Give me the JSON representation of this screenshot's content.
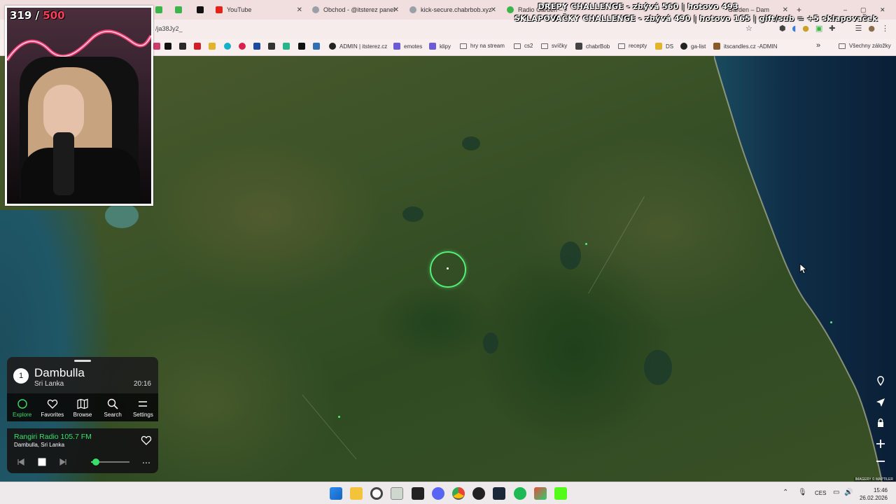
{
  "browser": {
    "tabs": [
      {
        "label": "YouTube",
        "favicon_color": "#e62117"
      },
      {
        "label": "Obchod - @itsterez panel",
        "favicon_color": "#9aa0a6"
      },
      {
        "label": "kick-secure.chabrbob.xyz",
        "favicon_color": "#9aa0a6"
      },
      {
        "label": "Radio Garden – Ke",
        "favicon_color": "#3bb54a"
      },
      {
        "label": "Garden – Dam",
        "favicon_color": "#3bb54a"
      }
    ],
    "new_tab_symbol": "+",
    "url": "/ja38Jy2_",
    "bookmarks": [
      {
        "label": "ADMIN | itsterez.cz",
        "icon_color": "#222"
      },
      {
        "label": "emotes",
        "icon_color": "#6b5bd6"
      },
      {
        "label": "klipy",
        "icon_color": "#6b5bd6"
      },
      {
        "label": "hry na stream",
        "icon_color": "folder"
      },
      {
        "label": "cs2",
        "icon_color": "folder"
      },
      {
        "label": "svíčky",
        "icon_color": "folder"
      },
      {
        "label": "chabrBob",
        "icon_color": "#444"
      },
      {
        "label": "recepty",
        "icon_color": "folder"
      },
      {
        "label": "DS",
        "icon_color": "#e3b42a"
      },
      {
        "label": "ga-list",
        "icon_color": "#222"
      },
      {
        "label": "itscandles.cz -ADMIN",
        "icon_color": "#8a5a2b"
      }
    ],
    "all_bookmarks": "Všechny záložky",
    "overflow_symbol": "»"
  },
  "overlay": {
    "challenge_1": "DREPY CHALLENGE - zbývá 560 | hotovo 493",
    "challenge_2": "SKLAPOVAČKY CHALLENGE - zbývá 490 | hotovo 165 | gift/sub = +5 sklapovaček",
    "counter_current": "319",
    "counter_sep": " / ",
    "counter_goal": "500"
  },
  "radio": {
    "rank": "1",
    "city": "Dambulla",
    "country": "Sri Lanka",
    "local_time": "20:16",
    "nav": [
      {
        "label": "Explore",
        "icon": "explore-icon",
        "active": true
      },
      {
        "label": "Favorites",
        "icon": "heart-icon",
        "active": false
      },
      {
        "label": "Browse",
        "icon": "map-icon",
        "active": false
      },
      {
        "label": "Search",
        "icon": "search-icon",
        "active": false
      },
      {
        "label": "Settings",
        "icon": "menu-icon",
        "active": false
      }
    ],
    "station": "Rangiri Radio 105.7 FM",
    "station_location": "Dambulla, Sri Lanka",
    "volume": 0.13,
    "more_symbol": "⋯",
    "accent": "#38e06a"
  },
  "map": {
    "attribution": "IMAGERY © MAPTILER"
  },
  "taskbar": {
    "language": "CES",
    "time": "15:46",
    "date": "26.02.2026"
  }
}
